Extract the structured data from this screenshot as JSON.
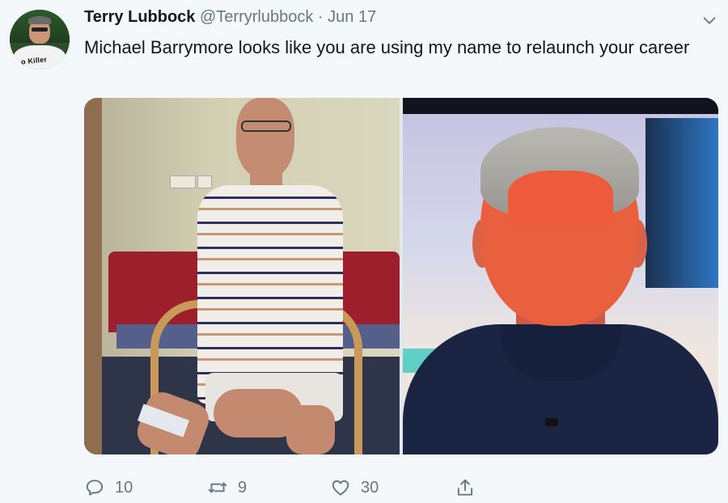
{
  "tweet": {
    "author_name": "Terry Lubbock",
    "handle": "@Terryrlubbock",
    "separator": "·",
    "date": "Jun 17",
    "text": "Michael Barrymore looks like you are using my name to relaunch your career",
    "avatar_shirt_text": "o Killer"
  },
  "actions": {
    "reply_count": "10",
    "retweet_count": "9",
    "like_count": "30"
  },
  "icons": {
    "menu": "chevron-down-icon",
    "reply": "reply-icon",
    "retweet": "retweet-icon",
    "like": "heart-icon",
    "share": "share-icon"
  },
  "colors": {
    "background": "#f5f8fa",
    "text": "#14171a",
    "secondary": "#657786"
  }
}
